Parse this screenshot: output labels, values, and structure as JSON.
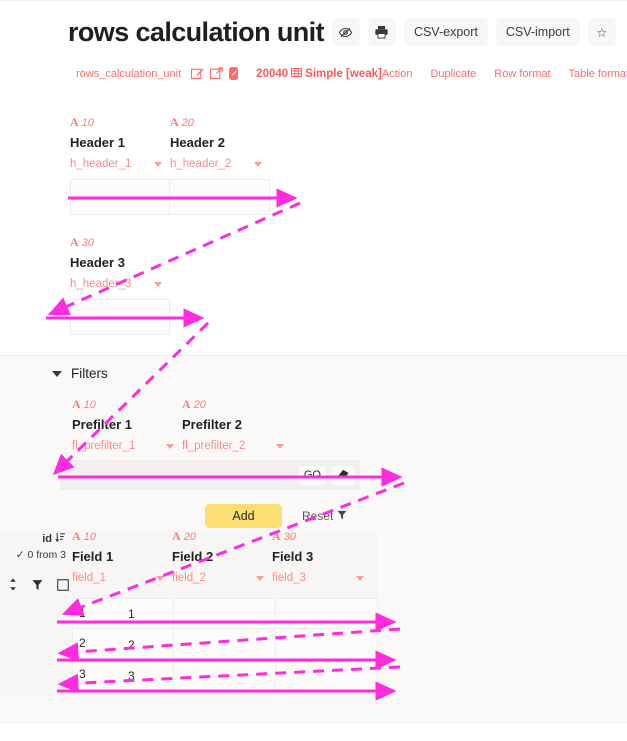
{
  "header": {
    "title": "rows calculation unit",
    "buttons": [
      {
        "name": "hide-icon",
        "label": "",
        "icon": "eye-slash-icon"
      },
      {
        "name": "print-icon",
        "label": "",
        "icon": "printer-icon"
      },
      {
        "name": "csv-export",
        "label": "CSV-export",
        "icon": ""
      },
      {
        "name": "csv-import",
        "label": "CSV-import",
        "icon": ""
      },
      {
        "name": "favorite",
        "label": "☆",
        "icon": "star-icon"
      }
    ]
  },
  "subbar": {
    "table_id": "rows_calculation_unit",
    "icons": [
      "edit-icon",
      "external-link-icon",
      "note-icon"
    ],
    "meta_number": "20040",
    "meta_text": "Simple [weak]",
    "links": [
      "Action",
      "Duplicate",
      "Row format",
      "Table format"
    ]
  },
  "header_fields_group1": [
    {
      "type_letter": "A",
      "type_num": "10",
      "label": "Header 1",
      "name": "h_header_1",
      "value": ""
    },
    {
      "type_letter": "A",
      "type_num": "20",
      "label": "Header 2",
      "name": "h_header_2",
      "value": ""
    }
  ],
  "header_fields_group2": [
    {
      "type_letter": "A",
      "type_num": "30",
      "label": "Header 3",
      "name": "h_header_3",
      "value": ""
    }
  ],
  "filters": {
    "section_title": "Filters",
    "expanded": true,
    "fields": [
      {
        "type_letter": "A",
        "type_num": "10",
        "label": "Prefilter 1",
        "name": "fl_prefilter_1",
        "value": ""
      },
      {
        "type_letter": "A",
        "type_num": "20",
        "label": "Prefilter 2",
        "name": "fl_prefilter_2",
        "value": ""
      }
    ],
    "go_label": "GO",
    "erase_icon": "eraser-icon",
    "add_label": "Add",
    "reset_label": "Reset",
    "reset_icon": "funnel-icon"
  },
  "grid": {
    "id_header": "id",
    "sort_icon": "sort-icon",
    "selection_text": "✓ 0 from 3",
    "row_icons": [
      "updown-sort-icon",
      "funnel-icon",
      "checkbox-icon"
    ],
    "columns": [
      {
        "type_letter": "A",
        "type_num": "10",
        "label": "Field 1",
        "name": "field_1"
      },
      {
        "type_letter": "A",
        "type_num": "20",
        "label": "Field 2",
        "name": "field_2"
      },
      {
        "type_letter": "A",
        "type_num": "30",
        "label": "Field 3",
        "name": "field_3"
      }
    ],
    "rows": [
      {
        "id": "1",
        "cells": [
          "1",
          "",
          ""
        ]
      },
      {
        "id": "2",
        "cells": [
          "2",
          "",
          ""
        ]
      },
      {
        "id": "3",
        "cells": [
          "3",
          "",
          ""
        ]
      }
    ]
  },
  "colors": {
    "accent_red": "#ff6b6b",
    "accent_magenta": "#ff2bdd",
    "add_yellow": "#fcdf72",
    "panel_gray": "#f7f6f5"
  }
}
